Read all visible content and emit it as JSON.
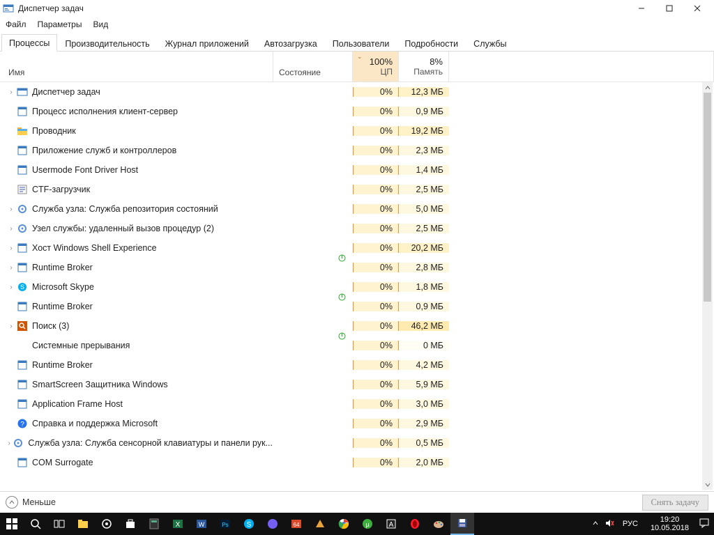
{
  "window": {
    "title": "Диспетчер задач"
  },
  "menu": {
    "file": "Файл",
    "options": "Параметры",
    "view": "Вид"
  },
  "tabs": {
    "processes": "Процессы",
    "performance": "Производительность",
    "app_history": "Журнал приложений",
    "startup": "Автозагрузка",
    "users": "Пользователи",
    "details": "Подробности",
    "services": "Службы"
  },
  "columns": {
    "name": "Имя",
    "status": "Состояние",
    "cpu": {
      "pct": "100%",
      "label": "ЦП"
    },
    "mem": {
      "pct": "8%",
      "label": "Память"
    }
  },
  "rows": [
    {
      "expand": true,
      "icon": "taskmgr",
      "name": "Диспетчер задач",
      "leaf": "",
      "cpu": "0%",
      "mem": "12,3 МБ",
      "mz": "z2"
    },
    {
      "expand": false,
      "icon": "generic",
      "name": "Процесс исполнения клиент-сервер",
      "leaf": "",
      "cpu": "0%",
      "mem": "0,9 МБ",
      "mz": "z1"
    },
    {
      "expand": false,
      "icon": "explorer",
      "name": "Проводник",
      "leaf": "",
      "cpu": "0%",
      "mem": "19,2 МБ",
      "mz": "z2"
    },
    {
      "expand": false,
      "icon": "generic",
      "name": "Приложение служб и контроллеров",
      "leaf": "",
      "cpu": "0%",
      "mem": "2,3 МБ",
      "mz": "z1"
    },
    {
      "expand": false,
      "icon": "generic",
      "name": "Usermode Font Driver Host",
      "leaf": "",
      "cpu": "0%",
      "mem": "1,4 МБ",
      "mz": "z1"
    },
    {
      "expand": false,
      "icon": "ctf",
      "name": "CTF-загрузчик",
      "leaf": "",
      "cpu": "0%",
      "mem": "2,5 МБ",
      "mz": "z1"
    },
    {
      "expand": true,
      "icon": "gear",
      "name": "Служба узла: Служба репозитория состояний",
      "leaf": "",
      "cpu": "0%",
      "mem": "5,0 МБ",
      "mz": "z1"
    },
    {
      "expand": true,
      "icon": "gear",
      "name": "Узел службы: удаленный вызов процедур (2)",
      "leaf": "",
      "cpu": "0%",
      "mem": "2,5 МБ",
      "mz": "z1"
    },
    {
      "expand": true,
      "icon": "generic",
      "name": "Хост Windows Shell Experience",
      "leaf": "leaf",
      "cpu": "0%",
      "mem": "20,2 МБ",
      "mz": "z2"
    },
    {
      "expand": true,
      "icon": "generic",
      "name": "Runtime Broker",
      "leaf": "",
      "cpu": "0%",
      "mem": "2,8 МБ",
      "mz": "z1"
    },
    {
      "expand": true,
      "icon": "skype",
      "name": "Microsoft Skype",
      "leaf": "leaf",
      "cpu": "0%",
      "mem": "1,8 МБ",
      "mz": "z1"
    },
    {
      "expand": false,
      "icon": "generic",
      "name": "Runtime Broker",
      "leaf": "",
      "cpu": "0%",
      "mem": "0,9 МБ",
      "mz": "z1"
    },
    {
      "expand": true,
      "icon": "search",
      "name": "Поиск (3)",
      "leaf": "leaf",
      "cpu": "0%",
      "mem": "46,2 МБ",
      "mz": "z3"
    },
    {
      "expand": false,
      "icon": "blank",
      "name": "Системные прерывания",
      "leaf": "",
      "cpu": "0%",
      "mem": "0 МБ",
      "mz": "z0"
    },
    {
      "expand": false,
      "icon": "generic",
      "name": "Runtime Broker",
      "leaf": "",
      "cpu": "0%",
      "mem": "4,2 МБ",
      "mz": "z1"
    },
    {
      "expand": false,
      "icon": "generic",
      "name": "SmartScreen Защитника Windows",
      "leaf": "",
      "cpu": "0%",
      "mem": "5,9 МБ",
      "mz": "z1"
    },
    {
      "expand": false,
      "icon": "generic",
      "name": "Application Frame Host",
      "leaf": "",
      "cpu": "0%",
      "mem": "3,0 МБ",
      "mz": "z1"
    },
    {
      "expand": false,
      "icon": "help",
      "name": "Справка и поддержка Microsoft",
      "leaf": "",
      "cpu": "0%",
      "mem": "2,9 МБ",
      "mz": "z1"
    },
    {
      "expand": true,
      "icon": "gear",
      "name": "Служба узла: Служба сенсорной клавиатуры и панели рук...",
      "leaf": "",
      "cpu": "0%",
      "mem": "0,5 МБ",
      "mz": "z1"
    },
    {
      "expand": false,
      "icon": "generic",
      "name": "COM Surrogate",
      "leaf": "",
      "cpu": "0%",
      "mem": "2,0 МБ",
      "mz": "z1"
    }
  ],
  "bottom": {
    "less": "Меньше",
    "end_task": "Снять задачу"
  },
  "tray": {
    "lang": "РУС",
    "time": "19:20",
    "date": "10.05.2018"
  }
}
